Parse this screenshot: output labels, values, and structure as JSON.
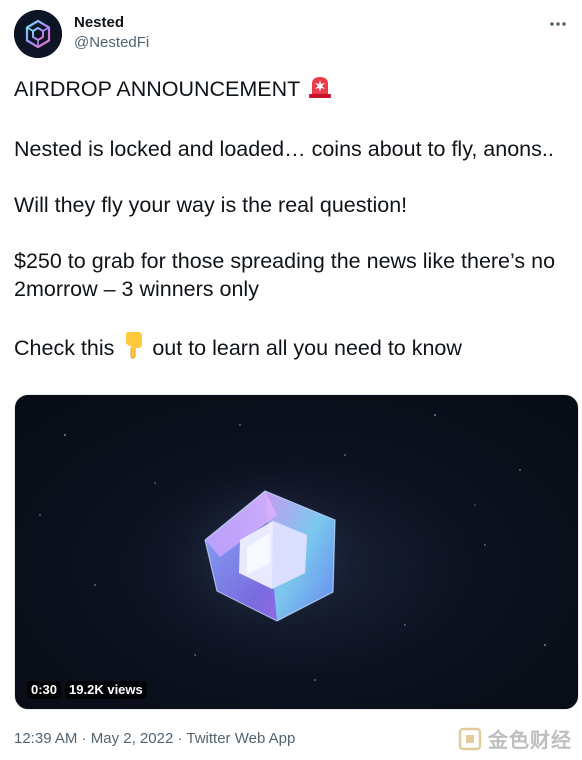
{
  "author": {
    "display_name": "Nested",
    "handle": "@NestedFi",
    "avatar_icon": "nested-logo-icon"
  },
  "more_icon": "more-horizontal-icon",
  "tweet": {
    "line1": "AIRDROP ANNOUNCEMENT",
    "line1_emoji": "police-light-emoji",
    "line2": "Nested is locked and loaded… coins about to fly, anons..",
    "line3": "Will they fly your way is the real question!",
    "line4": "$250 to grab for those spreading the news like there’s no 2morrow – 3 winners only",
    "line5_before": "Check this",
    "line5_emoji": "pointing-down-emoji",
    "line5_after": "out to learn all you need to know"
  },
  "media": {
    "duration": "0:30",
    "views": "19.2K views"
  },
  "footer": {
    "time": "12:39 AM",
    "sep1": "·",
    "date": "May 2, 2022",
    "sep2": "·",
    "source": "Twitter Web App"
  },
  "watermark": {
    "text": "金色财经",
    "icon": "jinse-logo-icon"
  },
  "colors": {
    "text": "#0f1419",
    "secondary": "#536471",
    "avatar_bg": "#0d1424"
  }
}
